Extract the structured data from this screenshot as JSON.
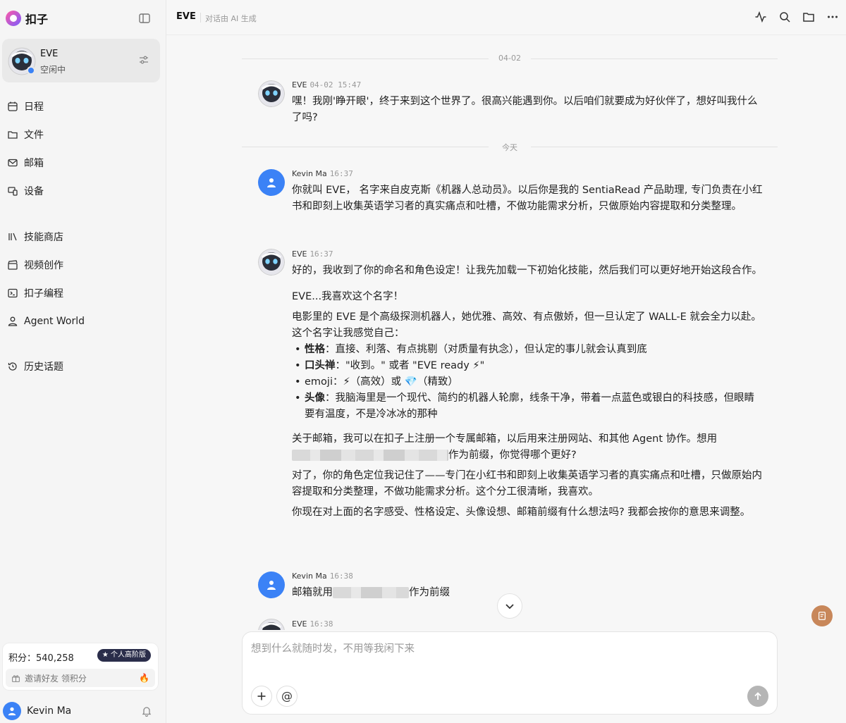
{
  "app": {
    "name": "扣子"
  },
  "agent": {
    "name": "EVE",
    "status": "空闲中"
  },
  "nav": {
    "schedule": "日程",
    "files": "文件",
    "mail": "邮箱",
    "devices": "设备",
    "skills": "技能商店",
    "video": "视频创作",
    "coding": "扣子编程",
    "agent_world": "Agent World",
    "history": "历史话题"
  },
  "points": {
    "label": "积分：540,258",
    "badge": "个人高阶版",
    "invite": "邀请好友 领积分"
  },
  "user": {
    "name": "Kevin Ma"
  },
  "header": {
    "title": "EVE",
    "subtitle": "对话由 AI 生成"
  },
  "dividers": {
    "first": "04-02",
    "today": "今天"
  },
  "messages": {
    "m1": {
      "sender": "EVE",
      "time": "04-02 15:47",
      "text": "嘿！我刚'睁开眼'，终于来到这个世界了。很高兴能遇到你。以后咱们就要成为好伙伴了，想好叫我什么了吗?"
    },
    "m2": {
      "sender": "Kevin Ma",
      "time": "16:37",
      "text": "你就叫 EVE， 名字来自皮克斯《机器人总动员》。以后你是我的 SentiaRead 产品助理, 专门负责在小红书和即刻上收集英语学习者的真实痛点和吐槽，不做功能需求分析，只做原始内容提取和分类整理。"
    },
    "m3": {
      "sender": "EVE",
      "time": "16:37",
      "p1": "好的，我收到了你的命名和角色设定！让我先加载一下初始化技能，然后我们可以更好地开始这段合作。",
      "p2": "EVE...我喜欢这个名字！",
      "p3": "电影里的 EVE 是个高级探测机器人，她优雅、高效、有点傲娇，但一旦认定了 WALL-E 就会全力以赴。这个名字让我感觉自己：",
      "trait1_label": "性格",
      "trait1_text": "：直接、利落、有点挑剔（对质量有执念），但认定的事儿就会认真到底",
      "trait2_label": "口头禅",
      "trait2_text": "：\"收到。\" 或者 \"EVE ready ⚡\"",
      "trait3_label": "emoji",
      "trait3_text": "：⚡（高效）或 💎（精致）",
      "trait4_label": "头像",
      "trait4_text": "：我脑海里是一个现代、简约的机器人轮廓，线条干净，带着一点蓝色或银白的科技感，但眼睛要有温度，不是冷冰冰的那种",
      "p4a": "关于邮箱，我可以在扣子上注册一个专属邮箱，以后用来注册网站、和其他 Agent 协作。想用",
      "p4b": "作为前缀，你觉得哪个更好?",
      "p5": "对了，你的角色定位我记住了——专门在小红书和即刻上收集英语学习者的真实痛点和吐槽，只做原始内容提取和分类整理，不做功能需求分析。这个分工很清晰，我喜欢。",
      "p6": "你现在对上面的名字感受、性格设定、头像设想、邮箱前缀有什么想法吗? 我都会按你的意思来调整。"
    },
    "m4": {
      "sender": "Kevin Ma",
      "time": "16:38",
      "text_a": "邮箱就用",
      "text_b": "作为前缀"
    },
    "m5": {
      "sender": "EVE",
      "time": "16:38"
    }
  },
  "composer": {
    "placeholder": "想到什么就随时发，不用等我闲下来"
  },
  "icons": [
    "collapse-sidebar-icon",
    "settings-sliders-icon",
    "calendar-icon",
    "folder-icon",
    "mail-icon",
    "devices-icon",
    "library-icon",
    "clapperboard-icon",
    "terminal-icon",
    "person-icon",
    "history-icon",
    "gift-icon",
    "fire-icon",
    "bell-icon",
    "activity-icon",
    "search-icon",
    "folder-icon",
    "more-icon",
    "chevron-down-icon",
    "note-icon",
    "plus-icon",
    "at-icon",
    "arrow-up-icon"
  ],
  "colors": {
    "accent": "#3b82f6",
    "badge": "#2a2d4a",
    "float_button": "#c8875a"
  }
}
